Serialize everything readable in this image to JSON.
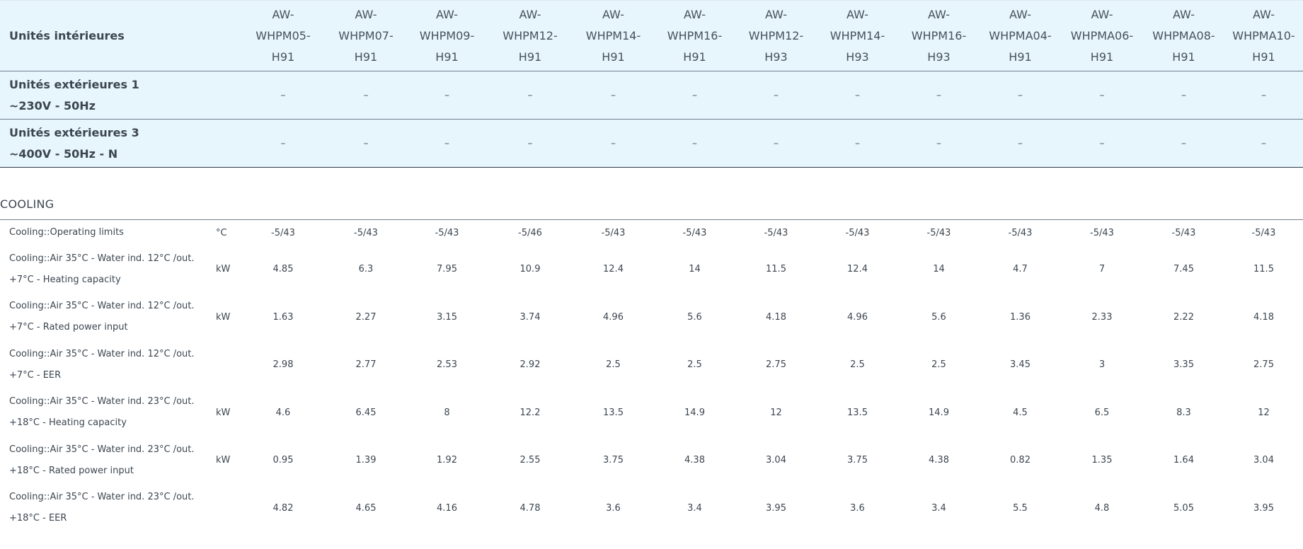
{
  "header": {
    "indoor_label": "Unités intérieures",
    "models": [
      [
        "AW-",
        "WHPM05-",
        "H91"
      ],
      [
        "AW-",
        "WHPM07-",
        "H91"
      ],
      [
        "AW-",
        "WHPM09-",
        "H91"
      ],
      [
        "AW-",
        "WHPM12-",
        "H91"
      ],
      [
        "AW-",
        "WHPM14-",
        "H91"
      ],
      [
        "AW-",
        "WHPM16-",
        "H91"
      ],
      [
        "AW-",
        "WHPM12-",
        "H93"
      ],
      [
        "AW-",
        "WHPM14-",
        "H93"
      ],
      [
        "AW-",
        "WHPM16-",
        "H93"
      ],
      [
        "AW-",
        "WHPMA04-",
        "H91"
      ],
      [
        "AW-",
        "WHPMA06-",
        "H91"
      ],
      [
        "AW-",
        "WHPMA08-",
        "H91"
      ],
      [
        "AW-",
        "WHPMA10-",
        "H91"
      ]
    ]
  },
  "outdoor_rows": [
    {
      "line1": "Unités extérieures 1",
      "line2": "~230V - 50Hz",
      "values": [
        "–",
        "–",
        "–",
        "–",
        "–",
        "–",
        "–",
        "–",
        "–",
        "–",
        "–",
        "–",
        "–"
      ]
    },
    {
      "line1": "Unités extérieures 3",
      "line2": "~400V - 50Hz - N",
      "values": [
        "–",
        "–",
        "–",
        "–",
        "–",
        "–",
        "–",
        "–",
        "–",
        "–",
        "–",
        "–",
        "–"
      ]
    }
  ],
  "section": {
    "title": "COOLING"
  },
  "rows": [
    {
      "line1": "Cooling::Operating limits",
      "line2": "",
      "unit": "°C",
      "values": [
        "-5/43",
        "-5/43",
        "-5/43",
        "-5/46",
        "-5/43",
        "-5/43",
        "-5/43",
        "-5/43",
        "-5/43",
        "-5/43",
        "-5/43",
        "-5/43",
        "-5/43"
      ]
    },
    {
      "line1": "Cooling::Air 35°C - Water ind. 12°C /out.",
      "line2": "+7°C - Heating capacity",
      "unit": "kW",
      "values": [
        "4.85",
        "6.3",
        "7.95",
        "10.9",
        "12.4",
        "14",
        "11.5",
        "12.4",
        "14",
        "4.7",
        "7",
        "7.45",
        "11.5"
      ]
    },
    {
      "line1": "Cooling::Air 35°C - Water ind. 12°C /out.",
      "line2": "+7°C - Rated power input",
      "unit": "kW",
      "values": [
        "1.63",
        "2.27",
        "3.15",
        "3.74",
        "4.96",
        "5.6",
        "4.18",
        "4.96",
        "5.6",
        "1.36",
        "2.33",
        "2.22",
        "4.18"
      ]
    },
    {
      "line1": "Cooling::Air 35°C - Water ind. 12°C /out.",
      "line2": "+7°C - EER",
      "unit": "",
      "values": [
        "2.98",
        "2.77",
        "2.53",
        "2.92",
        "2.5",
        "2.5",
        "2.75",
        "2.5",
        "2.5",
        "3.45",
        "3",
        "3.35",
        "2.75"
      ]
    },
    {
      "line1": "Cooling::Air 35°C - Water ind. 23°C /out.",
      "line2": "+18°C - Heating capacity",
      "unit": "kW",
      "values": [
        "4.6",
        "6.45",
        "8",
        "12.2",
        "13.5",
        "14.9",
        "12",
        "13.5",
        "14.9",
        "4.5",
        "6.5",
        "8.3",
        "12"
      ]
    },
    {
      "line1": "Cooling::Air 35°C - Water ind. 23°C /out.",
      "line2": "+18°C - Rated power input",
      "unit": "kW",
      "values": [
        "0.95",
        "1.39",
        "1.92",
        "2.55",
        "3.75",
        "4.38",
        "3.04",
        "3.75",
        "4.38",
        "0.82",
        "1.35",
        "1.64",
        "3.04"
      ]
    },
    {
      "line1": "Cooling::Air 35°C - Water ind. 23°C /out.",
      "line2": "+18°C - EER",
      "unit": "",
      "values": [
        "4.82",
        "4.65",
        "4.16",
        "4.78",
        "3.6",
        "3.4",
        "3.95",
        "3.6",
        "3.4",
        "5.5",
        "4.8",
        "5.05",
        "3.95"
      ]
    }
  ],
  "colors": {
    "header_bg": "#e7f5fc",
    "text": "#3c4650",
    "rule": "#6f7f8d"
  }
}
